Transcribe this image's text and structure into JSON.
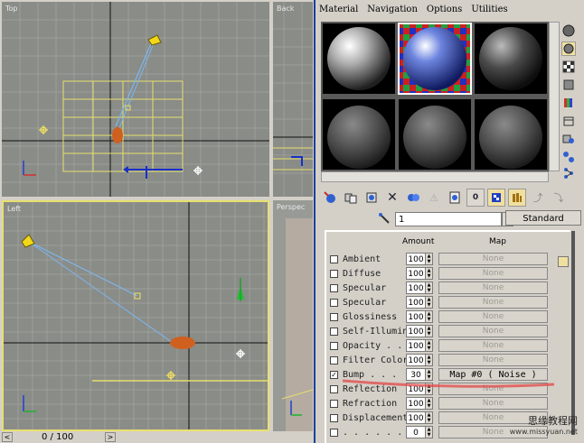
{
  "viewports": {
    "top_label": "Top",
    "back_label": "Back",
    "left_label": "Left",
    "perspective_label": "Perspec"
  },
  "timeline": {
    "frame_display": "0 / 100",
    "prev_icon": "left-chevron-icon",
    "next_icon": "right-chevron-icon"
  },
  "material_editor": {
    "menu": [
      "Material",
      "Navigation",
      "Options",
      "Utilities"
    ],
    "material_name": "1",
    "type_button": "Standard",
    "table": {
      "amount_header": "Amount",
      "map_header": "Map"
    },
    "maps": [
      {
        "channel": "Ambient",
        "amount": "100",
        "map": "None",
        "checked": false
      },
      {
        "channel": "Diffuse",
        "amount": "100",
        "map": "None",
        "checked": false
      },
      {
        "channel": "Specular",
        "amount": "100",
        "map": "None",
        "checked": false
      },
      {
        "channel": "Specular",
        "amount": "100",
        "map": "None",
        "checked": false
      },
      {
        "channel": "Glossiness",
        "amount": "100",
        "map": "None",
        "checked": false
      },
      {
        "channel": "Self-Illumin",
        "amount": "100",
        "map": "None",
        "checked": false
      },
      {
        "channel": "Opacity . .",
        "amount": "100",
        "map": "None",
        "checked": false
      },
      {
        "channel": "Filter Color",
        "amount": "100",
        "map": "None",
        "checked": false
      },
      {
        "channel": "Bump . . .",
        "amount": "30",
        "map": "Map #0  ( Noise )",
        "checked": true
      },
      {
        "channel": "Reflection",
        "amount": "100",
        "map": "None",
        "checked": false
      },
      {
        "channel": "Refraction",
        "amount": "100",
        "map": "None",
        "checked": false
      },
      {
        "channel": "Displacement",
        "amount": "100",
        "map": "None",
        "checked": false
      },
      {
        "channel": ". . . . . .",
        "amount": "0",
        "map": "None",
        "checked": false
      }
    ]
  },
  "watermark": {
    "line1": "思缘教程网",
    "line2": "www.missyuan.net"
  },
  "colors": {
    "viewport_bg": "#8a8c88",
    "grid_line": "#9a9c98",
    "active_border": "#e8e070",
    "accent_blue": "#1c3f9c",
    "selection_yellow": "#f0e060",
    "highlight_red": "#e05050"
  }
}
